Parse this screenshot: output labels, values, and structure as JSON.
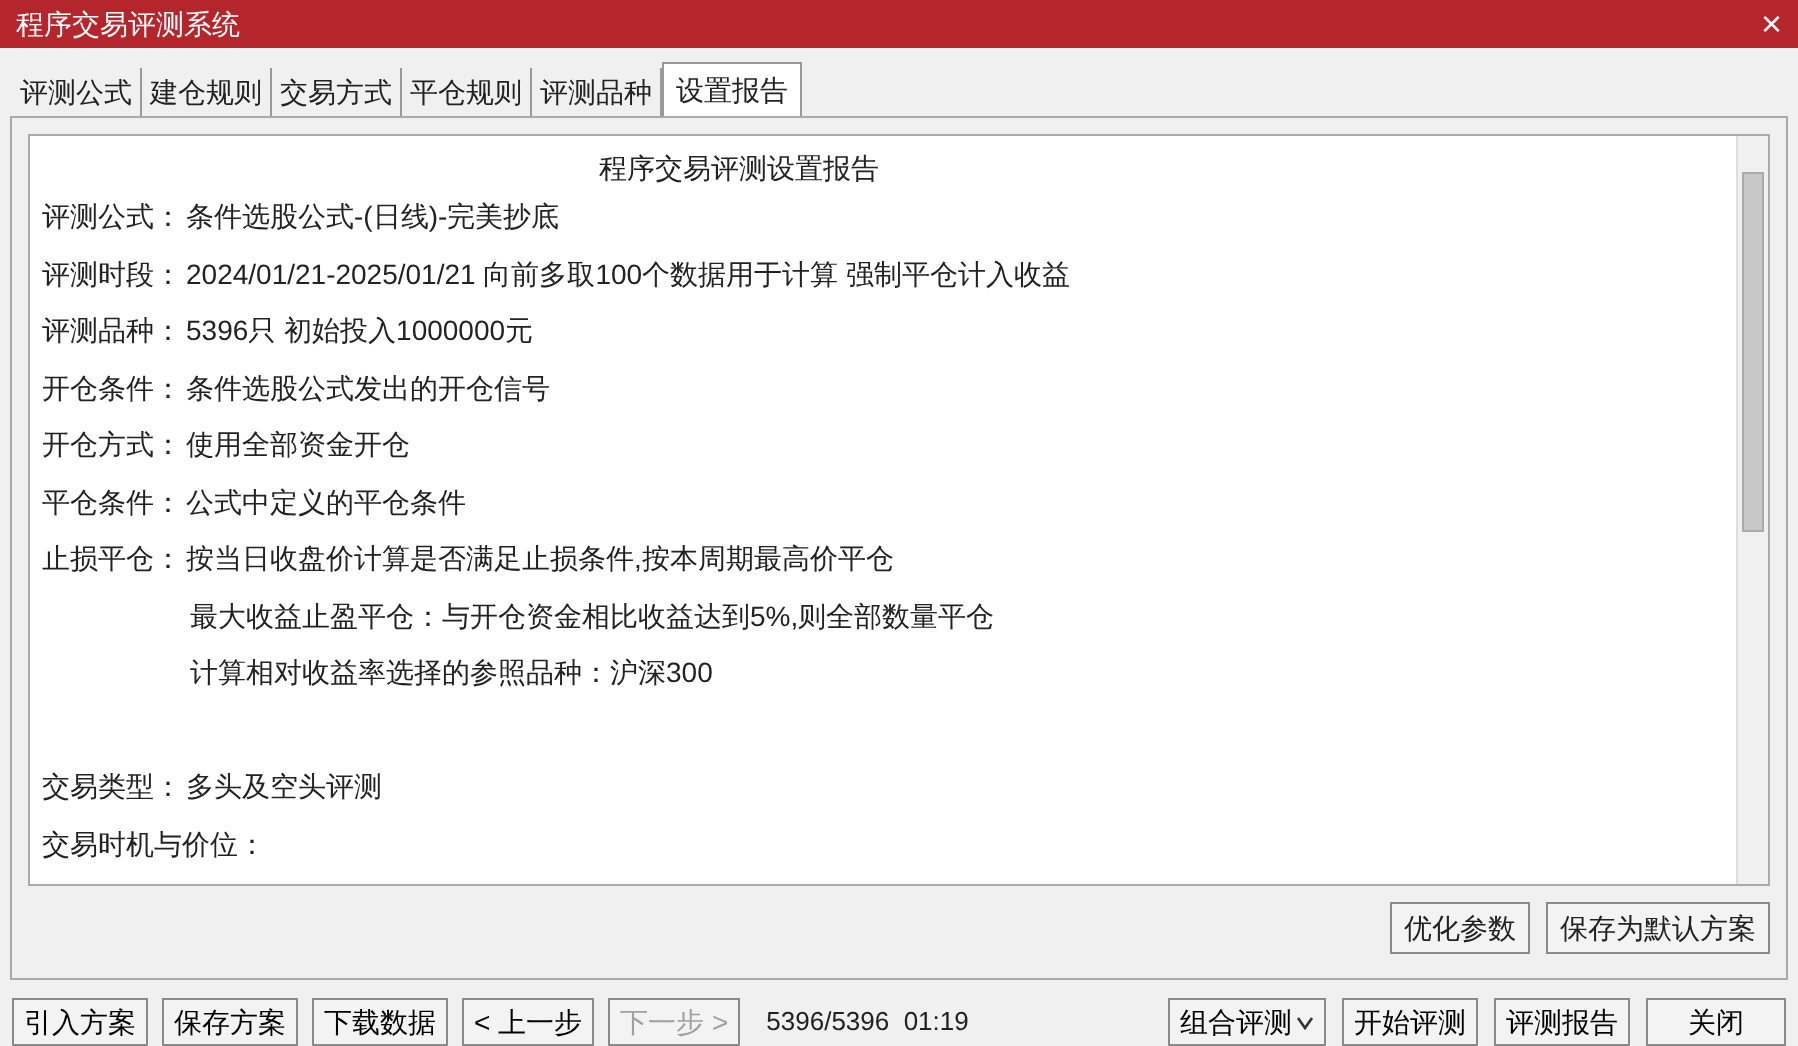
{
  "window": {
    "title": "程序交易评测系统",
    "close": "×"
  },
  "tabs": [
    {
      "label": "评测公式",
      "selected": false
    },
    {
      "label": "建仓规则",
      "selected": false
    },
    {
      "label": "交易方式",
      "selected": false
    },
    {
      "label": "平仓规则",
      "selected": false
    },
    {
      "label": "评测品种",
      "selected": false
    },
    {
      "label": "设置报告",
      "selected": true
    }
  ],
  "report": {
    "title": "程序交易评测设置报告",
    "lines": [
      {
        "kind": "field",
        "label": "评测公式：",
        "value": "条件选股公式-(日线)-完美抄底"
      },
      {
        "kind": "field",
        "label": "评测时段：",
        "value": "2024/01/21-2025/01/21 向前多取100个数据用于计算 强制平仓计入收益"
      },
      {
        "kind": "field",
        "label": "评测品种：",
        "value": "5396只 初始投入1000000元"
      },
      {
        "kind": "field",
        "label": "开仓条件：",
        "value": "条件选股公式发出的开仓信号"
      },
      {
        "kind": "field",
        "label": "开仓方式：",
        "value": "使用全部资金开仓"
      },
      {
        "kind": "field",
        "label": "平仓条件：",
        "value": "公式中定义的平仓条件"
      },
      {
        "kind": "field",
        "label": "止损平仓：",
        "value": "按当日收盘价计算是否满足止损条件,按本周期最高价平仓"
      },
      {
        "kind": "indent",
        "value": "最大收益止盈平仓：与开仓资金相比收益达到5%,则全部数量平仓"
      },
      {
        "kind": "indent",
        "value": "计算相对收益率选择的参照品种：沪深300"
      },
      {
        "kind": "spacer"
      },
      {
        "kind": "field",
        "label": "交易类型：",
        "value": "多头及空头评测"
      },
      {
        "kind": "field",
        "label": "交易时机与价位："
      }
    ]
  },
  "panel_buttons": [
    "优化参数",
    "保存为默认方案"
  ],
  "footer_left": [
    {
      "label": "引入方案",
      "disabled": false
    },
    {
      "label": "保存方案",
      "disabled": false
    },
    {
      "label": "下载数据",
      "disabled": false
    },
    {
      "label": "< 上一步",
      "disabled": false
    },
    {
      "label": "下一步 >",
      "disabled": true
    }
  ],
  "status": "5396/5396  01:19",
  "footer_right": [
    {
      "label": "组合评测",
      "kind": "dropdown",
      "disabled": false
    },
    {
      "label": "开始评测",
      "kind": "button",
      "disabled": false
    },
    {
      "label": "评测报告",
      "kind": "button",
      "disabled": false
    },
    {
      "label": "关闭",
      "kind": "button",
      "disabled": false
    }
  ]
}
